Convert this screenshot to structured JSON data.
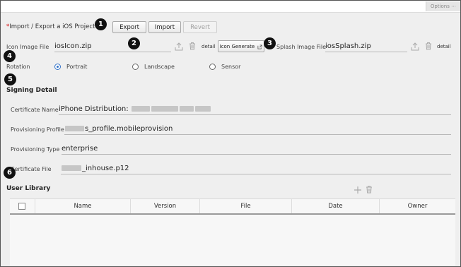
{
  "toolbar": {
    "options_label": "Options ⋯"
  },
  "project": {
    "required_mark": "*",
    "label": "Import / Export a iOS Project",
    "export_label": "Export",
    "import_label": "Import",
    "revert_label": "Revert"
  },
  "markers": [
    "1",
    "2",
    "3",
    "4",
    "5",
    "6"
  ],
  "icon_image": {
    "label": "Icon Image File",
    "value": "iosIcon.zip",
    "detail_label": "detail",
    "generate_label": "Icon Generate"
  },
  "splash_image": {
    "label": "Splash Image File",
    "value": "iosSplash.zip",
    "detail_label": "detail"
  },
  "rotation": {
    "label": "Rotation",
    "options": [
      "Portrait",
      "Landscape",
      "Sensor"
    ],
    "selected": "Portrait"
  },
  "signing": {
    "title": "Signing Detail",
    "certificate_name": {
      "label": "Certificate Name",
      "value_prefix": "iPhone Distribution:",
      "value_suffix": ""
    },
    "provisioning_profile": {
      "label": "Provisioning Profile",
      "value_prefix": "",
      "value_suffix": "s_profile.mobileprovision"
    },
    "provisioning_type": {
      "label": "Provisioning Type",
      "value": "enterprise"
    },
    "certificate_file": {
      "label": "Certificate File",
      "value_prefix": "",
      "value_suffix": "_inhouse.p12"
    }
  },
  "user_library": {
    "title": "User Library",
    "columns": [
      "Name",
      "Version",
      "File",
      "Date",
      "Owner"
    ]
  },
  "colors": {
    "accent": "#3372c8",
    "background": "#efefef",
    "required": "#d40000"
  }
}
